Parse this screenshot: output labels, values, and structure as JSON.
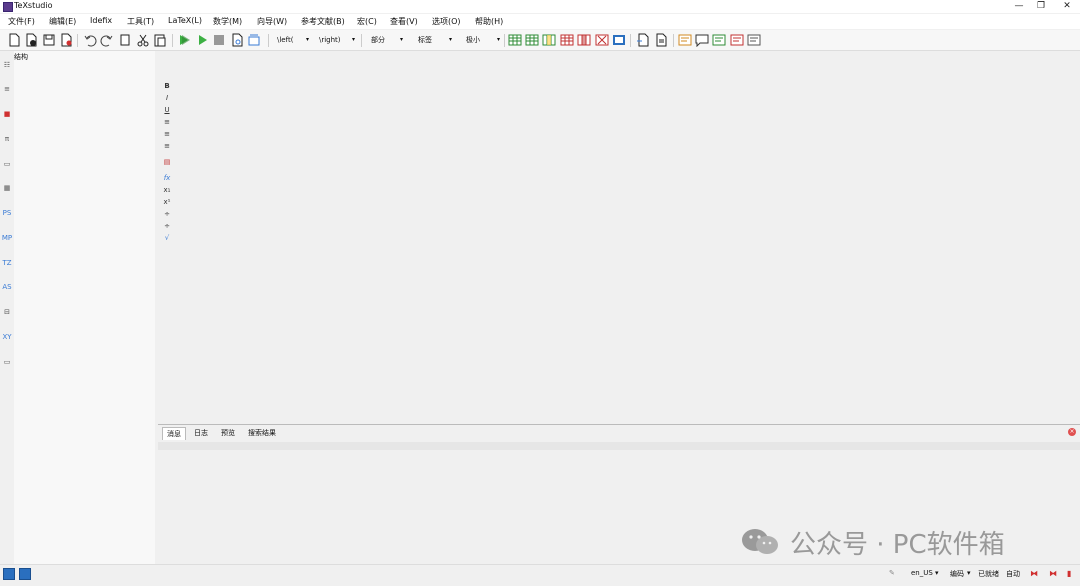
{
  "window": {
    "title": "TeXstudio",
    "minimize": "—",
    "maximize": "❐",
    "close": "✕"
  },
  "menu": [
    "文件(F)",
    "编辑(E)",
    "Idefix",
    "工具(T)",
    "LaTeX(L)",
    "数学(M)",
    "向导(W)",
    "参考文献(B)",
    "宏(C)",
    "查看(V)",
    "选项(O)",
    "帮助(H)"
  ],
  "toolbar": {
    "left_combo": "\\left(",
    "right_combo": "\\right)",
    "section_combo": "部分",
    "label_combo": "标签",
    "size_combo": "极小"
  },
  "structure_panel": {
    "title": "结构"
  },
  "left_sidebar_labels": [
    "PS",
    "MP",
    "TZ",
    "AS",
    "XY"
  ],
  "symbol_bar": [
    "B",
    "I",
    "U",
    "fx",
    "x₁",
    "x¹"
  ],
  "message_tabs": [
    "消息",
    "日志",
    "预览",
    "搜索结果"
  ],
  "status": {
    "language": "en_US",
    "encoding": "编码",
    "ready": "已就绪",
    "mode": "自动"
  },
  "watermark": "公众号 · PC软件箱"
}
